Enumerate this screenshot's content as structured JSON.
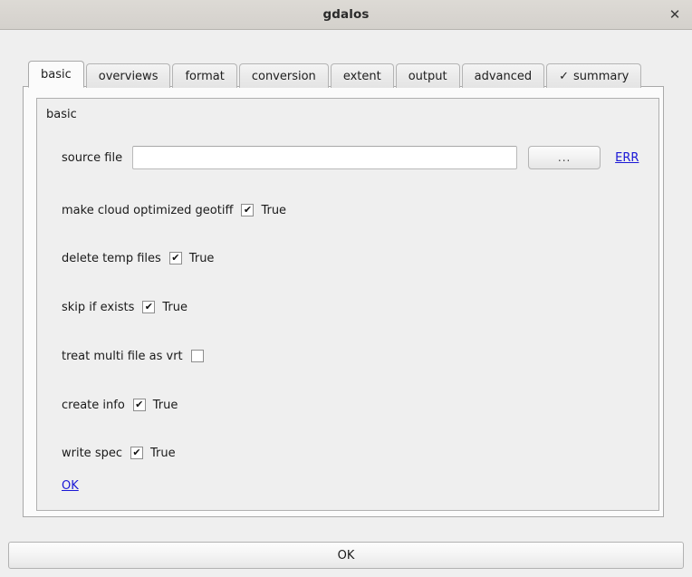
{
  "window": {
    "title": "gdalos",
    "close_label": "✕"
  },
  "tabs": [
    {
      "label": "basic",
      "active": true,
      "check": ""
    },
    {
      "label": "overviews",
      "active": false,
      "check": ""
    },
    {
      "label": "format",
      "active": false,
      "check": ""
    },
    {
      "label": "conversion",
      "active": false,
      "check": ""
    },
    {
      "label": "extent",
      "active": false,
      "check": ""
    },
    {
      "label": "output",
      "active": false,
      "check": ""
    },
    {
      "label": "advanced",
      "active": false,
      "check": ""
    },
    {
      "label": "summary",
      "active": false,
      "check": "✓"
    }
  ],
  "group": {
    "title": "basic"
  },
  "source_file": {
    "label": "source file",
    "value": "",
    "placeholder": "",
    "browse_label": "...",
    "error_label": "ERR"
  },
  "options": [
    {
      "label": "make cloud optimized geotiff",
      "checked": true,
      "value": "True"
    },
    {
      "label": "delete temp files",
      "checked": true,
      "value": "True"
    },
    {
      "label": "skip if exists",
      "checked": true,
      "value": "True"
    },
    {
      "label": "treat multi file as vrt",
      "checked": false,
      "value": ""
    },
    {
      "label": "create info",
      "checked": true,
      "value": "True"
    },
    {
      "label": "write spec",
      "checked": true,
      "value": "True"
    }
  ],
  "panel_ok": {
    "label": "OK"
  },
  "bottom_ok": {
    "label": "OK"
  },
  "colors": {
    "link": "#1a17d6",
    "titlebar": "#d8d5d0",
    "background": "#efefef",
    "panel": "#fbfbfb"
  }
}
